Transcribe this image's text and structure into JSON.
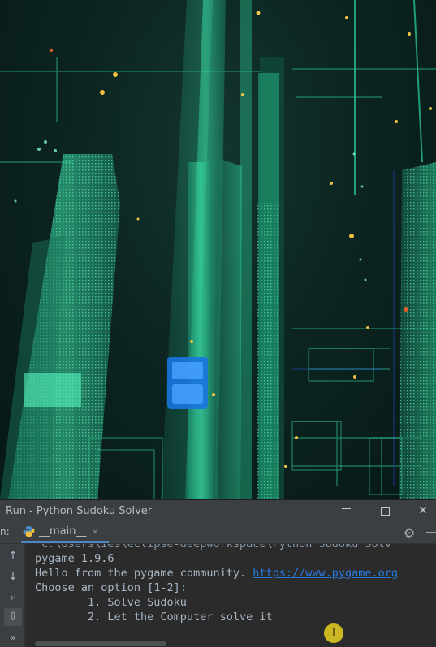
{
  "window": {
    "title": "Run - Python Sudoku Solver",
    "minimize_icon": "minimize-icon",
    "maximize_icon": "maximize-icon",
    "close_icon": "close-icon"
  },
  "tabbar": {
    "prefix": "n:",
    "tab_label": "__main__",
    "tab_close": "×",
    "tab_icon": "python-icon",
    "settings_icon": "gear-icon",
    "hide_icon": "minus-icon"
  },
  "toolbar": {
    "items": [
      {
        "icon": "arrow-up-icon",
        "glyph": "↑"
      },
      {
        "icon": "arrow-down-icon",
        "glyph": "↓"
      },
      {
        "icon": "soft-wrap-icon",
        "glyph": "⤶"
      },
      {
        "icon": "scroll-to-end-icon",
        "glyph": "⇩"
      },
      {
        "icon": "more-icon",
        "glyph": "»"
      }
    ]
  },
  "console": {
    "path_line": " C:\\Users\\ies\\eclipse-deepworkspace\\Python Sudoku Solv",
    "line1": "pygame 1.9.6",
    "line2_text": "Hello from the pygame community. ",
    "line2_link": "https://www.pygame.org",
    "line3": "Choose an option [1-2]:",
    "line4": "        1. Solve Sudoku",
    "line5": "        2. Let the Computer solve it"
  },
  "colors": {
    "console_bg": "#2b2b2b",
    "panel_bg": "#3c3f41",
    "text": "#a9b7c6",
    "link": "#287bde",
    "tab_underline": "#4a88c7",
    "wallpaper_accent": "#2fd6a0"
  }
}
